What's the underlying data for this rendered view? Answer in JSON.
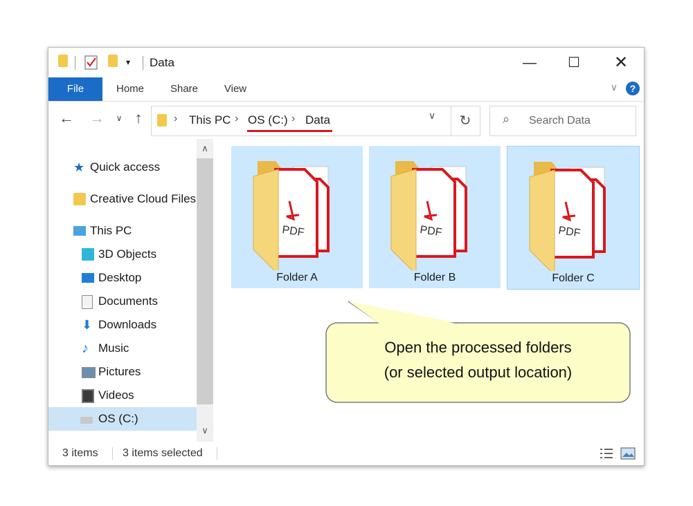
{
  "window": {
    "title": "Data"
  },
  "titlebar": {
    "qat_icons": [
      "folder-icon",
      "properties-checkbox-icon",
      "new-folder-icon",
      "customize-qat-icon"
    ],
    "buttons": [
      "minimize-icon",
      "maximize-icon",
      "close-icon"
    ]
  },
  "ribbon": {
    "tabs": [
      "File",
      "Home",
      "Share",
      "View"
    ],
    "help": "?"
  },
  "navigation": {
    "back_icon": "back-arrow-icon",
    "forward_icon": "forward-arrow-icon",
    "recent_icon": "chevron-down-icon",
    "up_icon": "up-arrow-icon",
    "breadcrumb": [
      "This PC",
      "OS (C:)",
      "Data"
    ],
    "search_placeholder": "Search Data"
  },
  "sidebar": {
    "items": [
      {
        "label": "Quick access",
        "icon": "star-icon"
      },
      {
        "label": "Creative Cloud Files",
        "icon": "creative-cloud-folder-icon"
      },
      {
        "label": "This PC",
        "icon": "computer-icon"
      },
      {
        "label": "3D Objects",
        "icon": "cube-icon"
      },
      {
        "label": "Desktop",
        "icon": "desktop-icon"
      },
      {
        "label": "Documents",
        "icon": "document-icon"
      },
      {
        "label": "Downloads",
        "icon": "download-icon"
      },
      {
        "label": "Music",
        "icon": "music-note-icon"
      },
      {
        "label": "Pictures",
        "icon": "pictures-icon"
      },
      {
        "label": "Videos",
        "icon": "film-icon"
      },
      {
        "label": "OS (C:)",
        "icon": "drive-icon"
      }
    ],
    "selected": "OS (C:)"
  },
  "content": {
    "folders": [
      {
        "label": "Folder A"
      },
      {
        "label": "Folder B"
      },
      {
        "label": "Folder C"
      }
    ]
  },
  "status": {
    "items_count": "3 items",
    "selected_count": "3 items selected"
  },
  "callout": {
    "line1": "Open the processed folders",
    "line2": "(or selected output location)"
  },
  "colors": {
    "accent": "#1a6cc7",
    "selection": "#cce8ff",
    "underline": "#d9181f",
    "callout_fill": "#fdfdc8",
    "pdf_red": "#d9181f"
  }
}
